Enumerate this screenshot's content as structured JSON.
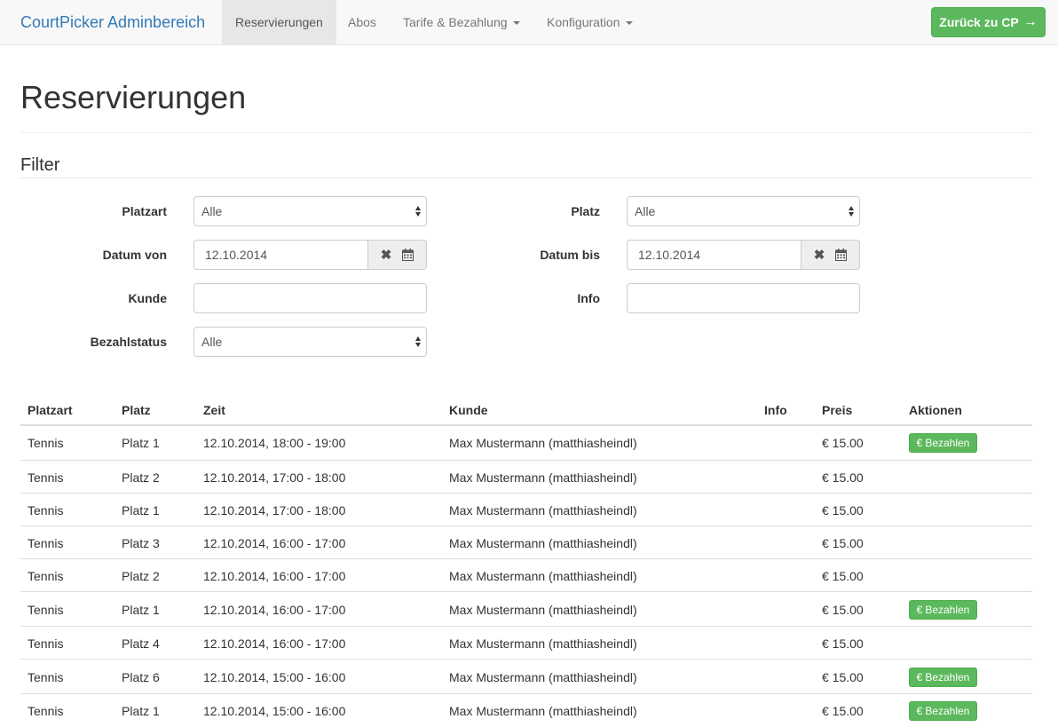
{
  "nav": {
    "brand": "CourtPicker Adminbereich",
    "items": [
      {
        "label": "Reservierungen"
      },
      {
        "label": "Abos"
      },
      {
        "label": "Tarife & Bezahlung"
      },
      {
        "label": "Konfiguration"
      }
    ],
    "back_button": "Zurück zu CP",
    "back_icon": "→"
  },
  "page": {
    "title": "Reservierungen",
    "filter_title": "Filter"
  },
  "filters": {
    "platzart": {
      "label": "Platzart",
      "value": "Alle"
    },
    "platz": {
      "label": "Platz",
      "value": "Alle"
    },
    "datum_von": {
      "label": "Datum von",
      "value": "12.10.2014"
    },
    "datum_bis": {
      "label": "Datum bis",
      "value": "12.10.2014"
    },
    "kunde": {
      "label": "Kunde",
      "value": ""
    },
    "info": {
      "label": "Info",
      "value": ""
    },
    "bezahlstatus": {
      "label": "Bezahlstatus",
      "value": "Alle"
    },
    "clear_icon": "✖"
  },
  "table": {
    "headers": [
      "Platzart",
      "Platz",
      "Zeit",
      "Kunde",
      "Info",
      "Preis",
      "Aktionen"
    ],
    "pay_label": "Bezahlen",
    "pay_icon": "€",
    "rows": [
      {
        "platzart": "Tennis",
        "platz": "Platz 1",
        "zeit": "12.10.2014, 18:00 - 19:00",
        "kunde": "Max Mustermann (matthiasheindl)",
        "info": "",
        "preis": "€ 15.00",
        "pay": true
      },
      {
        "platzart": "Tennis",
        "platz": "Platz 2",
        "zeit": "12.10.2014, 17:00 - 18:00",
        "kunde": "Max Mustermann (matthiasheindl)",
        "info": "",
        "preis": "€ 15.00",
        "pay": false
      },
      {
        "platzart": "Tennis",
        "platz": "Platz 1",
        "zeit": "12.10.2014, 17:00 - 18:00",
        "kunde": "Max Mustermann (matthiasheindl)",
        "info": "",
        "preis": "€ 15.00",
        "pay": false
      },
      {
        "platzart": "Tennis",
        "platz": "Platz 3",
        "zeit": "12.10.2014, 16:00 - 17:00",
        "kunde": "Max Mustermann (matthiasheindl)",
        "info": "",
        "preis": "€ 15.00",
        "pay": false
      },
      {
        "platzart": "Tennis",
        "platz": "Platz 2",
        "zeit": "12.10.2014, 16:00 - 17:00",
        "kunde": "Max Mustermann (matthiasheindl)",
        "info": "",
        "preis": "€ 15.00",
        "pay": false
      },
      {
        "platzart": "Tennis",
        "platz": "Platz 1",
        "zeit": "12.10.2014, 16:00 - 17:00",
        "kunde": "Max Mustermann (matthiasheindl)",
        "info": "",
        "preis": "€ 15.00",
        "pay": true
      },
      {
        "platzart": "Tennis",
        "platz": "Platz 4",
        "zeit": "12.10.2014, 16:00 - 17:00",
        "kunde": "Max Mustermann (matthiasheindl)",
        "info": "",
        "preis": "€ 15.00",
        "pay": false
      },
      {
        "platzart": "Tennis",
        "platz": "Platz 6",
        "zeit": "12.10.2014, 15:00 - 16:00",
        "kunde": "Max Mustermann (matthiasheindl)",
        "info": "",
        "preis": "€ 15.00",
        "pay": true
      },
      {
        "platzart": "Tennis",
        "platz": "Platz 1",
        "zeit": "12.10.2014, 15:00 - 16:00",
        "kunde": "Max Mustermann (matthiasheindl)",
        "info": "",
        "preis": "€ 15.00",
        "pay": true
      }
    ]
  },
  "colors": {
    "brand": "#337ab7",
    "success": "#5cb85c",
    "navbar_bg": "#f8f8f8"
  }
}
